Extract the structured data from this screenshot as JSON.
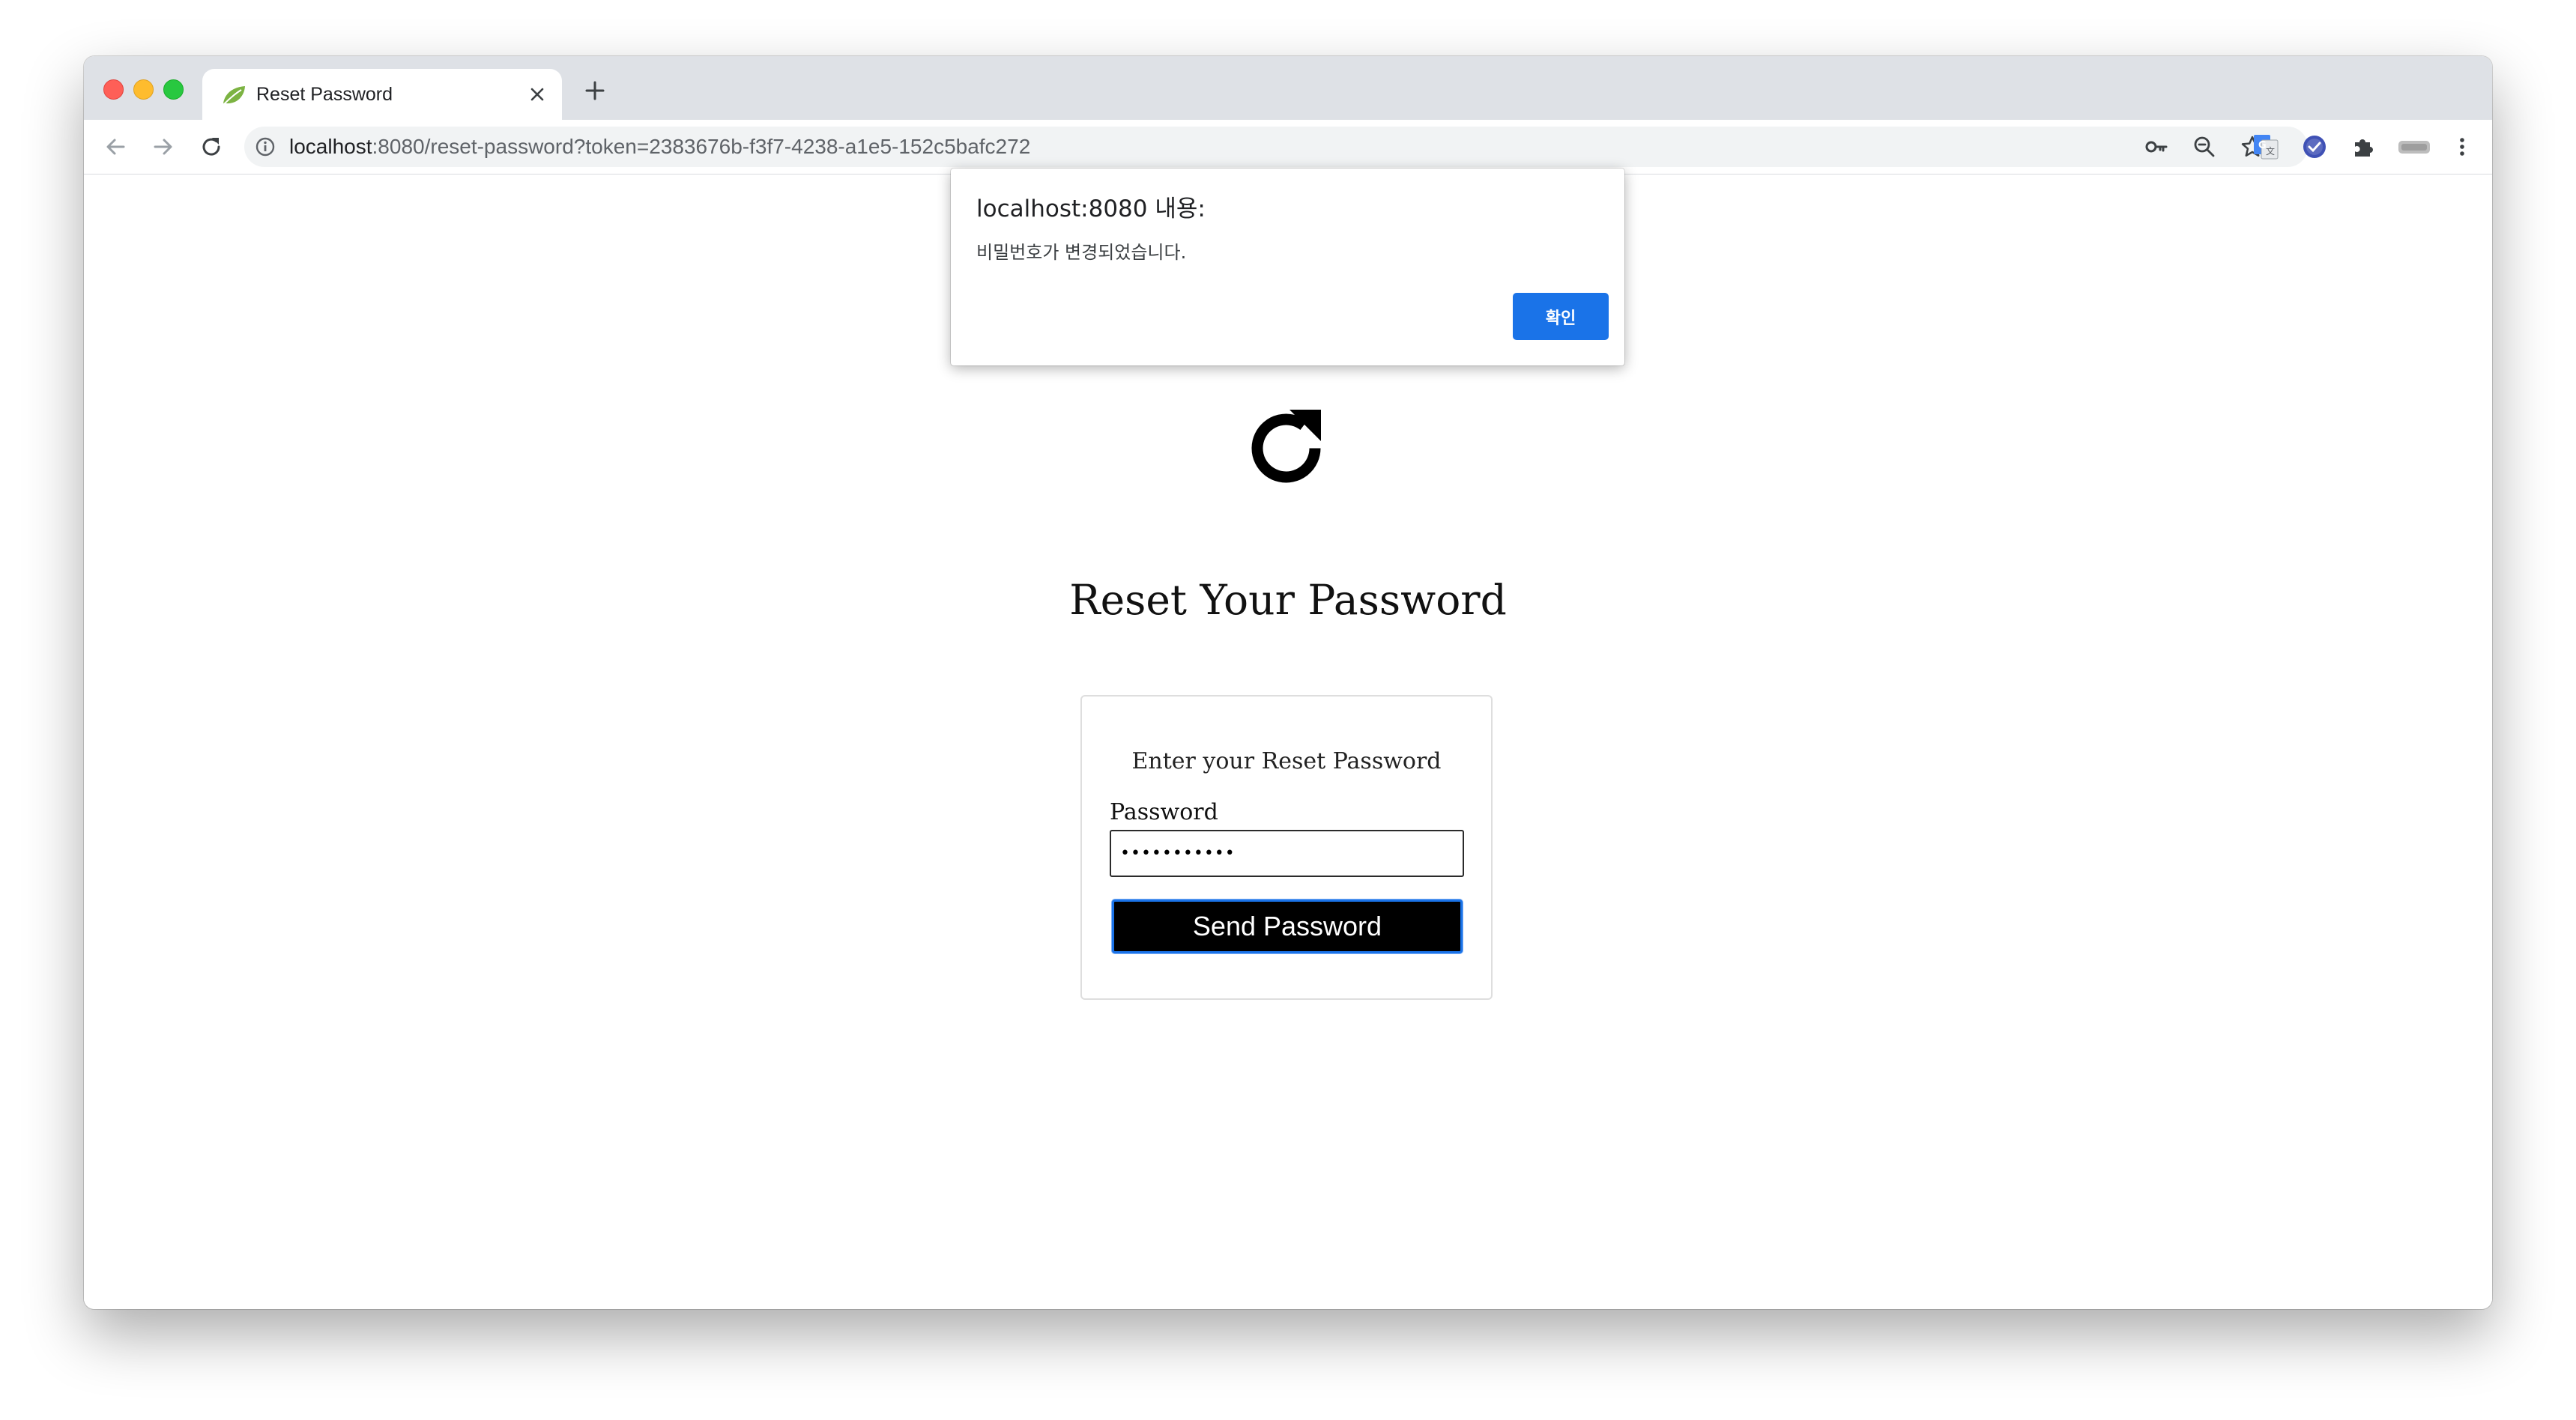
{
  "browser": {
    "tab": {
      "title": "Reset Password",
      "favicon": "leaf-icon"
    },
    "address": {
      "host": "localhost",
      "rest": ":8080/reset-password?token=2383676b-f3f7-4238-a1e5-152c5bafc272"
    }
  },
  "alert": {
    "title": "localhost:8080 내용:",
    "message": "비밀번호가 변경되었습니다.",
    "ok_label": "확인",
    "ok_color": "#1a73e8"
  },
  "page": {
    "icon": "refresh-icon",
    "title": "Reset Your Password",
    "form": {
      "subtitle": "Enter your Reset Password",
      "password_label": "Password",
      "password_value": "•••••••••••",
      "submit_label": "Send Password"
    }
  }
}
